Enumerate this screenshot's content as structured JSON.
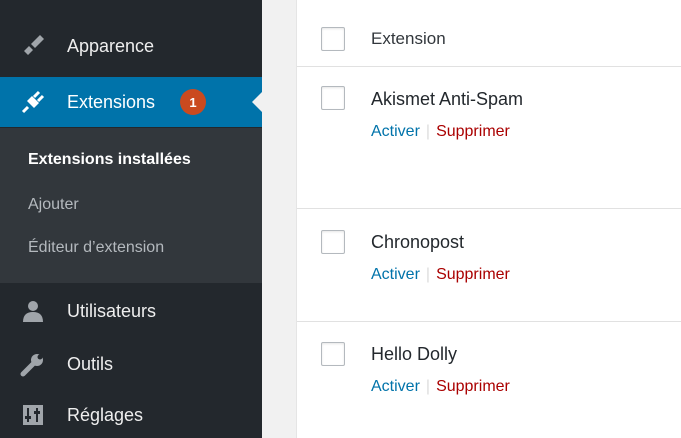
{
  "menu": {
    "appearance": {
      "label": "Apparence",
      "icon": "paintbrush-icon"
    },
    "plugins": {
      "label": "Extensions",
      "icon": "plugin-icon",
      "badge": "1"
    },
    "users": {
      "label": "Utilisateurs",
      "icon": "user-icon"
    },
    "tools": {
      "label": "Outils",
      "icon": "wrench-icon"
    },
    "settings": {
      "label": "Réglages",
      "icon": "sliders-icon"
    }
  },
  "submenu": {
    "installed": "Extensions installées",
    "add": "Ajouter",
    "editor": "Éditeur d’extension"
  },
  "table": {
    "column_header": "Extension",
    "plugins": [
      {
        "name": "Akismet Anti-Spam",
        "activate": "Activer",
        "delete": "Supprimer"
      },
      {
        "name": "Chronopost",
        "activate": "Activer",
        "delete": "Supprimer"
      },
      {
        "name": "Hello Dolly",
        "activate": "Activer",
        "delete": "Supprimer"
      }
    ]
  },
  "colors": {
    "sidebar": "#23282d",
    "submenu": "#32373c",
    "accent": "#0073aa",
    "badge": "#ca4a1f",
    "delete": "#aa0000"
  }
}
